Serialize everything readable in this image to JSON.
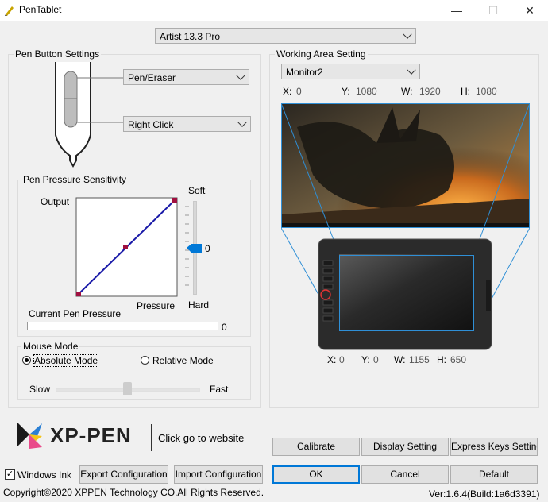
{
  "window": {
    "title": "PenTablet",
    "minimize": "—",
    "maximize": "☐",
    "close": "✕"
  },
  "device": {
    "selected": "Artist 13.3 Pro"
  },
  "pen_buttons": {
    "group_label": "Pen Button Settings",
    "button1": "Pen/Eraser",
    "button2": "Right Click"
  },
  "pressure": {
    "group_label": "Pen Pressure Sensitivity",
    "output_label": "Output",
    "pressure_label": "Pressure",
    "soft_label": "Soft",
    "hard_label": "Hard",
    "slider_value": "0",
    "current_label": "Current Pen Pressure",
    "current_value": "0",
    "current_level": 0
  },
  "mouse_mode": {
    "group_label": "Mouse Mode",
    "absolute": "Absolute Mode",
    "relative": "Relative Mode",
    "selected": "absolute",
    "slow": "Slow",
    "fast": "Fast",
    "speed_level": 0.5
  },
  "working_area": {
    "group_label": "Working Area Setting",
    "monitor": "Monitor2",
    "screen": {
      "x_label": "X:",
      "x": "0",
      "y_label": "Y:",
      "y": "1080",
      "w_label": "W:",
      "w": "1920",
      "h_label": "H:",
      "h": "1080"
    },
    "tablet": {
      "x_label": "X:",
      "x": "0",
      "y_label": "Y:",
      "y": "0",
      "w_label": "W:",
      "w": "1155",
      "h_label": "H:",
      "h": "650"
    }
  },
  "brand": {
    "name": "XP-PEN",
    "link": "Click go to website"
  },
  "buttons": {
    "calibrate": "Calibrate",
    "display_setting": "Display Setting",
    "express_keys": "Express Keys Setting",
    "windows_ink": "Windows Ink",
    "windows_ink_checked": true,
    "export": "Export Configuration",
    "import": "Import Configuration",
    "ok": "OK",
    "cancel": "Cancel",
    "default": "Default"
  },
  "footer": {
    "copyright": "Copyright©2020  XPPEN Technology CO.All Rights Reserved.",
    "version": "Ver:1.6.4(Build:1a6d3391)"
  },
  "colors": {
    "accent": "#0078d7",
    "curve": "#1a1aa8",
    "curve_point": "#a01040",
    "mapping_line": "#2f8fd6"
  }
}
